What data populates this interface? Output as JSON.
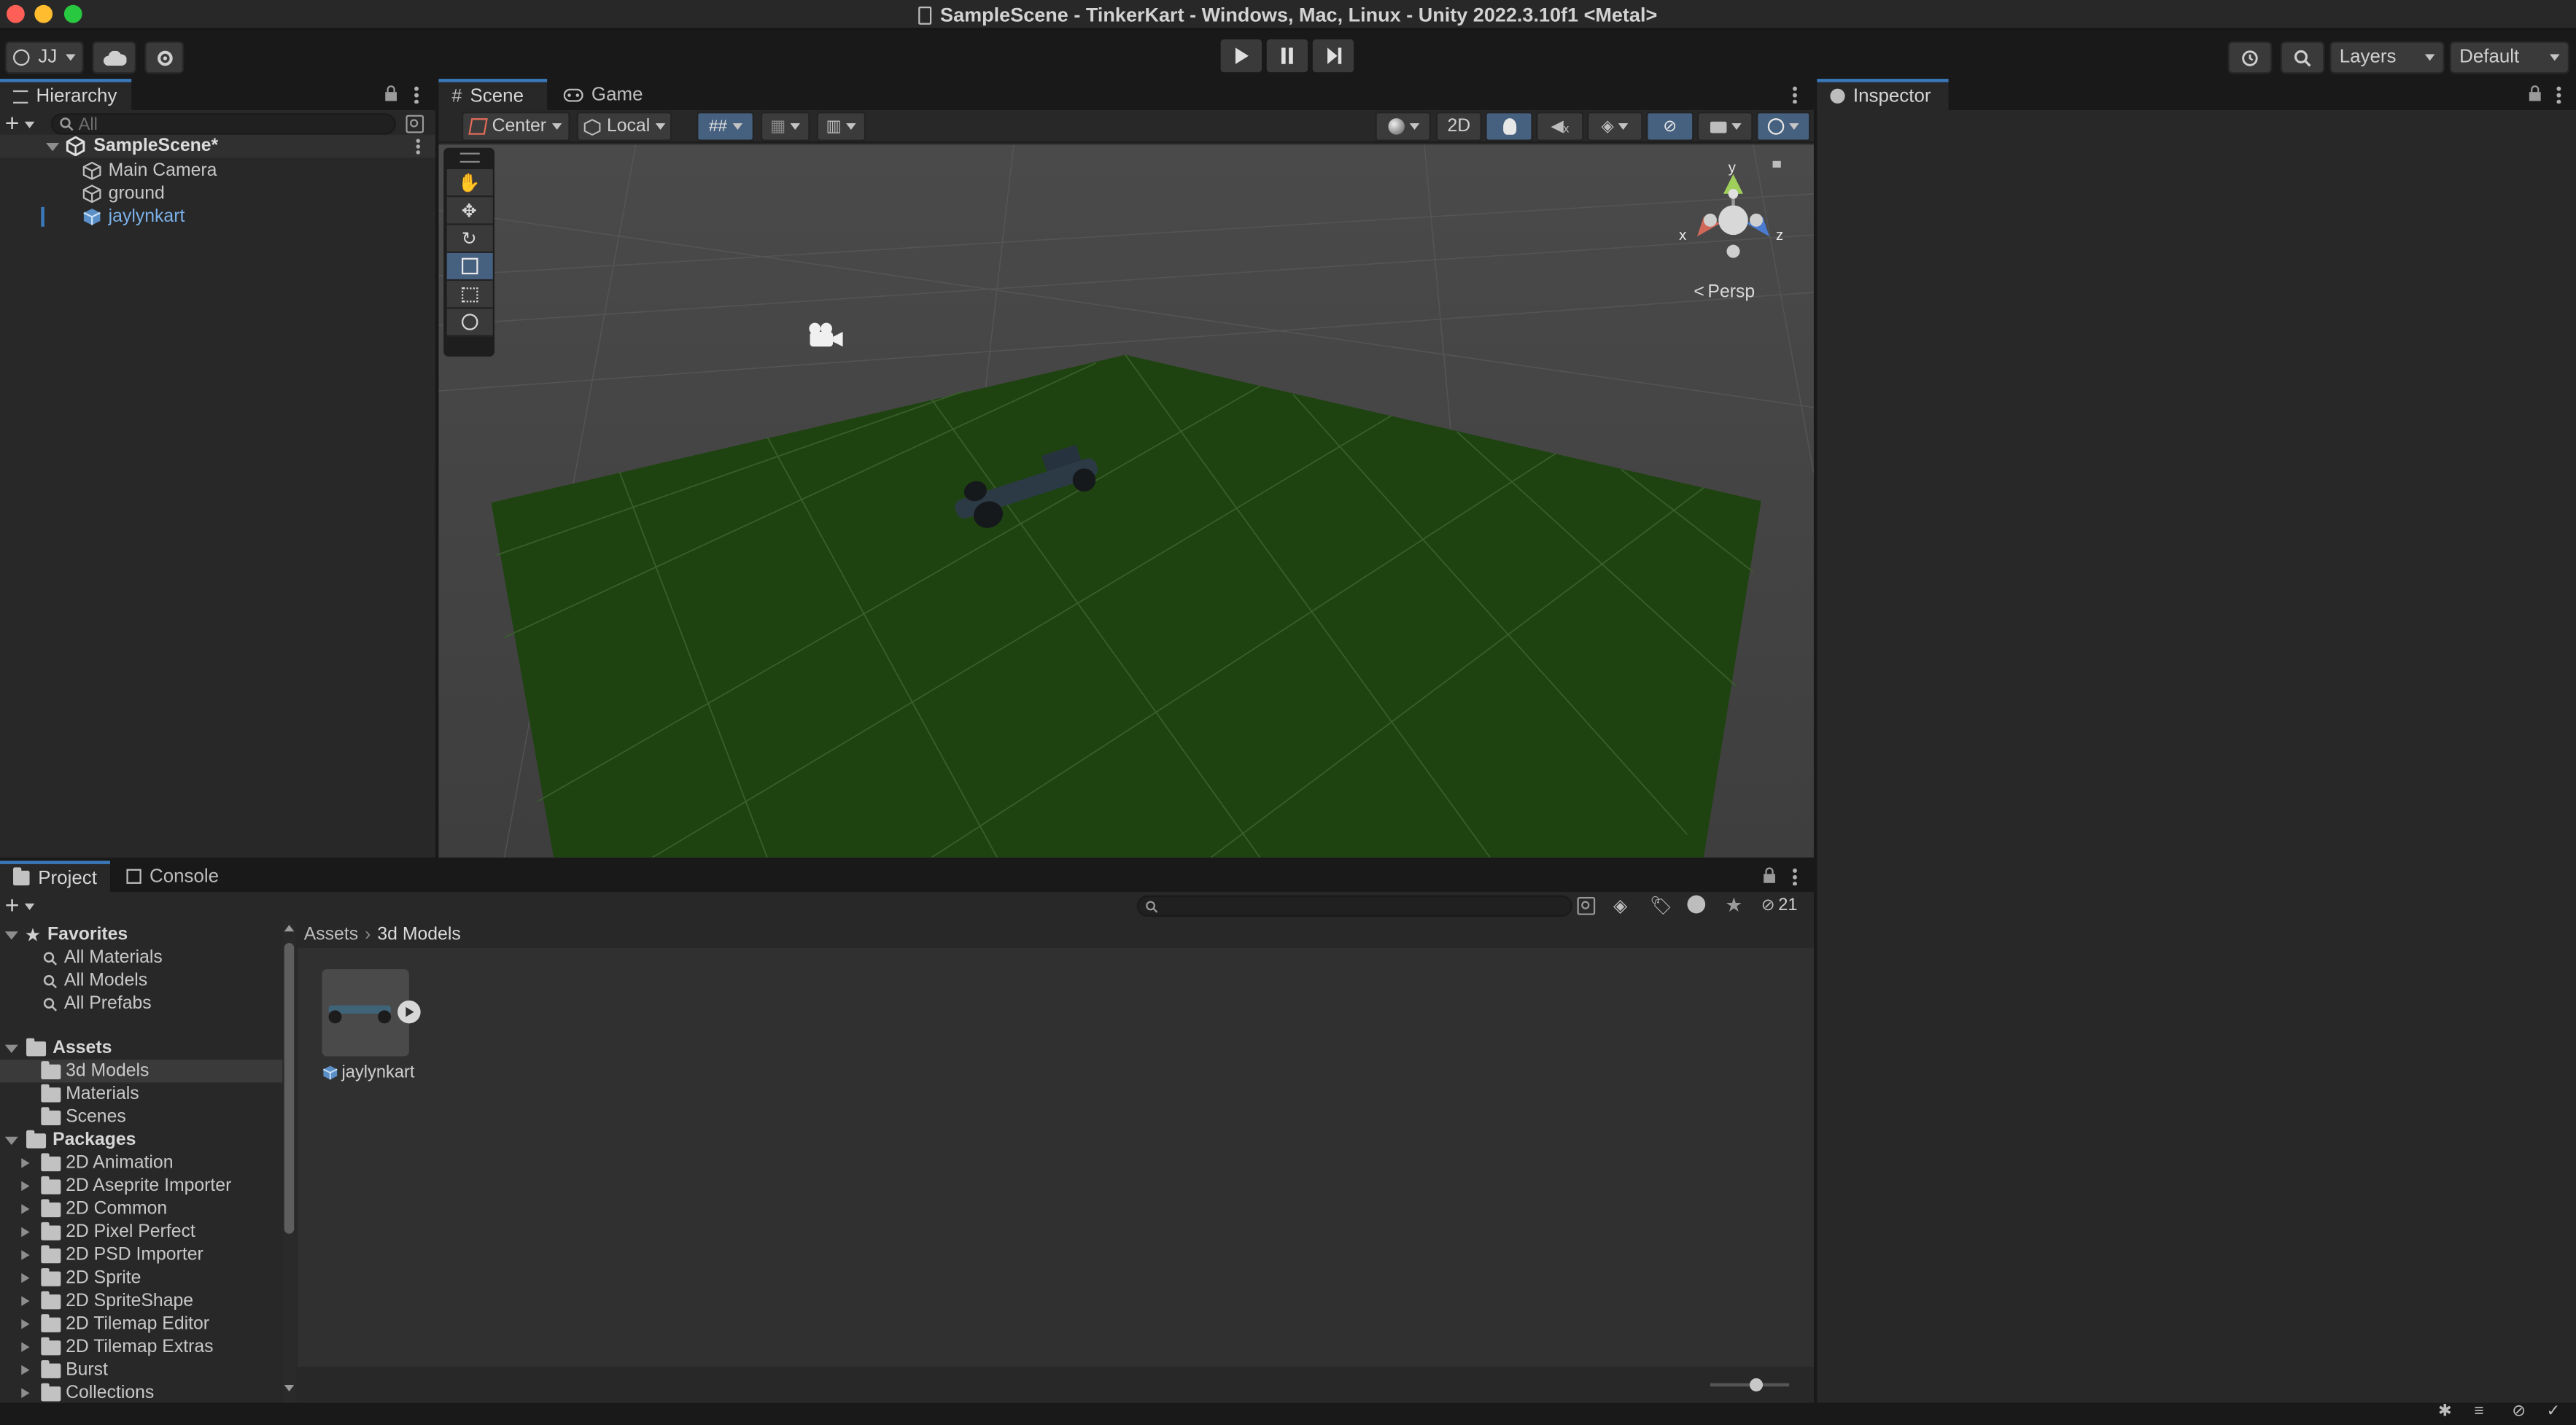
{
  "window": {
    "title": "SampleScene - TinkerKart - Windows, Mac, Linux - Unity 2022.3.10f1 <Metal>"
  },
  "toolbar": {
    "account_label": "JJ",
    "layers_label": "Layers",
    "layout_label": "Default"
  },
  "hierarchy": {
    "tab_label": "Hierarchy",
    "search_placeholder": "All",
    "scene_name": "SampleScene*",
    "items": [
      {
        "label": "Main Camera"
      },
      {
        "label": "ground"
      },
      {
        "label": "jaylynkart"
      }
    ]
  },
  "scene_view": {
    "tabs": [
      {
        "label": "Scene"
      },
      {
        "label": "Game"
      }
    ],
    "pivot_label": "Center",
    "space_label": "Local",
    "mode_2d_label": "2D",
    "projection_label": "Persp",
    "gizmo_axes": {
      "x": "x",
      "y": "y",
      "z": "z"
    }
  },
  "inspector": {
    "tab_label": "Inspector"
  },
  "project": {
    "tabs": [
      {
        "label": "Project"
      },
      {
        "label": "Console"
      }
    ],
    "hidden_count": "21",
    "breadcrumb": [
      "Assets",
      "3d Models"
    ],
    "favorites_label": "Favorites",
    "favorites": [
      {
        "label": "All Materials"
      },
      {
        "label": "All Models"
      },
      {
        "label": "All Prefabs"
      }
    ],
    "assets_label": "Assets",
    "assets": [
      {
        "label": "3d Models"
      },
      {
        "label": "Materials"
      },
      {
        "label": "Scenes"
      }
    ],
    "packages_label": "Packages",
    "packages": [
      {
        "label": "2D Animation"
      },
      {
        "label": "2D Aseprite Importer"
      },
      {
        "label": "2D Common"
      },
      {
        "label": "2D Pixel Perfect"
      },
      {
        "label": "2D PSD Importer"
      },
      {
        "label": "2D Sprite"
      },
      {
        "label": "2D SpriteShape"
      },
      {
        "label": "2D Tilemap Editor"
      },
      {
        "label": "2D Tilemap Extras"
      },
      {
        "label": "Burst"
      },
      {
        "label": "Collections"
      }
    ],
    "asset_items": [
      {
        "label": "jaylynkart"
      }
    ]
  },
  "colors": {
    "accent": "#3a79bb",
    "selection_text": "#7cb2ea",
    "ground": "#1f4310"
  }
}
